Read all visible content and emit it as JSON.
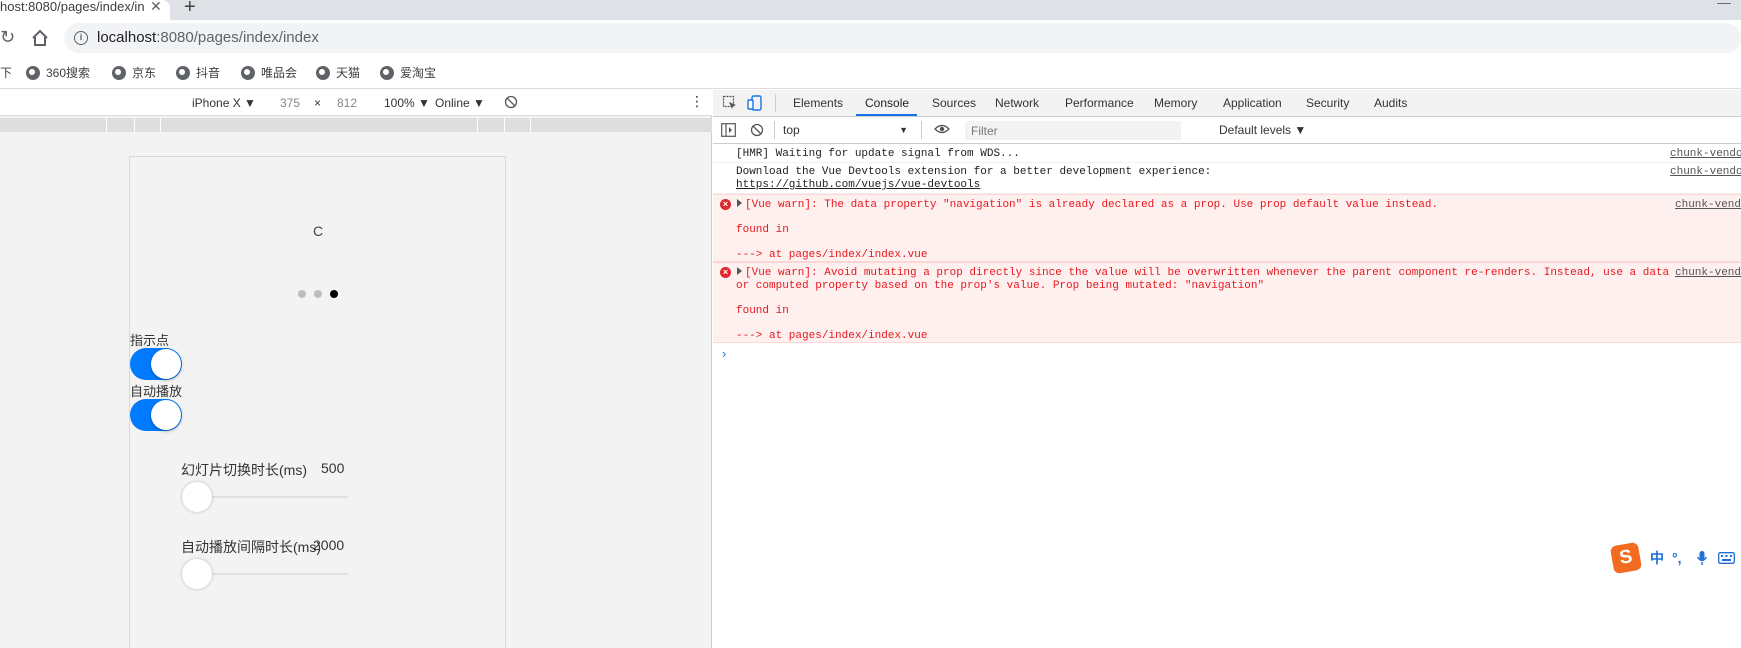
{
  "browser": {
    "tab_title": "host:8080/pages/index/in",
    "tab_close": "✕",
    "new_tab": "+",
    "url_host": "localhost",
    "url_rest": ":8080/pages/index/index"
  },
  "bookmarks": {
    "first": "下",
    "items": [
      "360搜索",
      "京东",
      "抖音",
      "唯品会",
      "天猫",
      "爱淘宝"
    ]
  },
  "device_toolbar": {
    "device": "iPhone X ▼",
    "width": "375",
    "times": "×",
    "height": "812",
    "zoom": "100% ▼",
    "network": "Online ▼",
    "more": "⋮"
  },
  "phone": {
    "swiper_text": "C",
    "dots_active_index": 2,
    "dot_count": 3,
    "indicator_label": "指示点",
    "autoplay_label": "自动播放",
    "duration_label": "幻灯片切换时长(ms)",
    "duration_value": "500",
    "interval_label": "自动播放间隔时长(ms)",
    "interval_value": "2000"
  },
  "devtools": {
    "tabs": [
      "Elements",
      "Console",
      "Sources",
      "Network",
      "Performance",
      "Memory",
      "Application",
      "Security",
      "Audits"
    ],
    "active_tab": "Console",
    "context": "top",
    "context_arrow": "▼",
    "filter_placeholder": "Filter",
    "levels": "Default levels ▼"
  },
  "console": {
    "m1": {
      "text": "[HMR] Waiting for update signal from WDS...",
      "src": "chunk-vendo"
    },
    "m2": {
      "line1": "Download the Vue Devtools extension for a better development experience:",
      "line2": "https://github.com/vuejs/vue-devtools",
      "src": "chunk-vendo"
    },
    "m3": {
      "line1": "[Vue warn]: The data property \"navigation\" is already declared as a prop. Use prop default value instead.",
      "line2": "found in",
      "line3": "---> at pages/index/index.vue",
      "src": "chunk-vend"
    },
    "m4": {
      "line1": "[Vue warn]: Avoid mutating a prop directly since the value will be overwritten whenever the parent component re-renders. Instead, use a data",
      "line2": "or computed property based on the prop's value. Prop being mutated: \"navigation\"",
      "line3": "found in",
      "line4": "---> at pages/index/index.vue",
      "src": "chunk-vend"
    },
    "prompt": "›"
  },
  "ime": {
    "logo": "S",
    "items": [
      "中",
      "°,",
      "🎤",
      "⌨"
    ]
  },
  "colors": {
    "accent": "#1a73e8",
    "switch_on": "#007aff",
    "error": "#e6191f"
  }
}
